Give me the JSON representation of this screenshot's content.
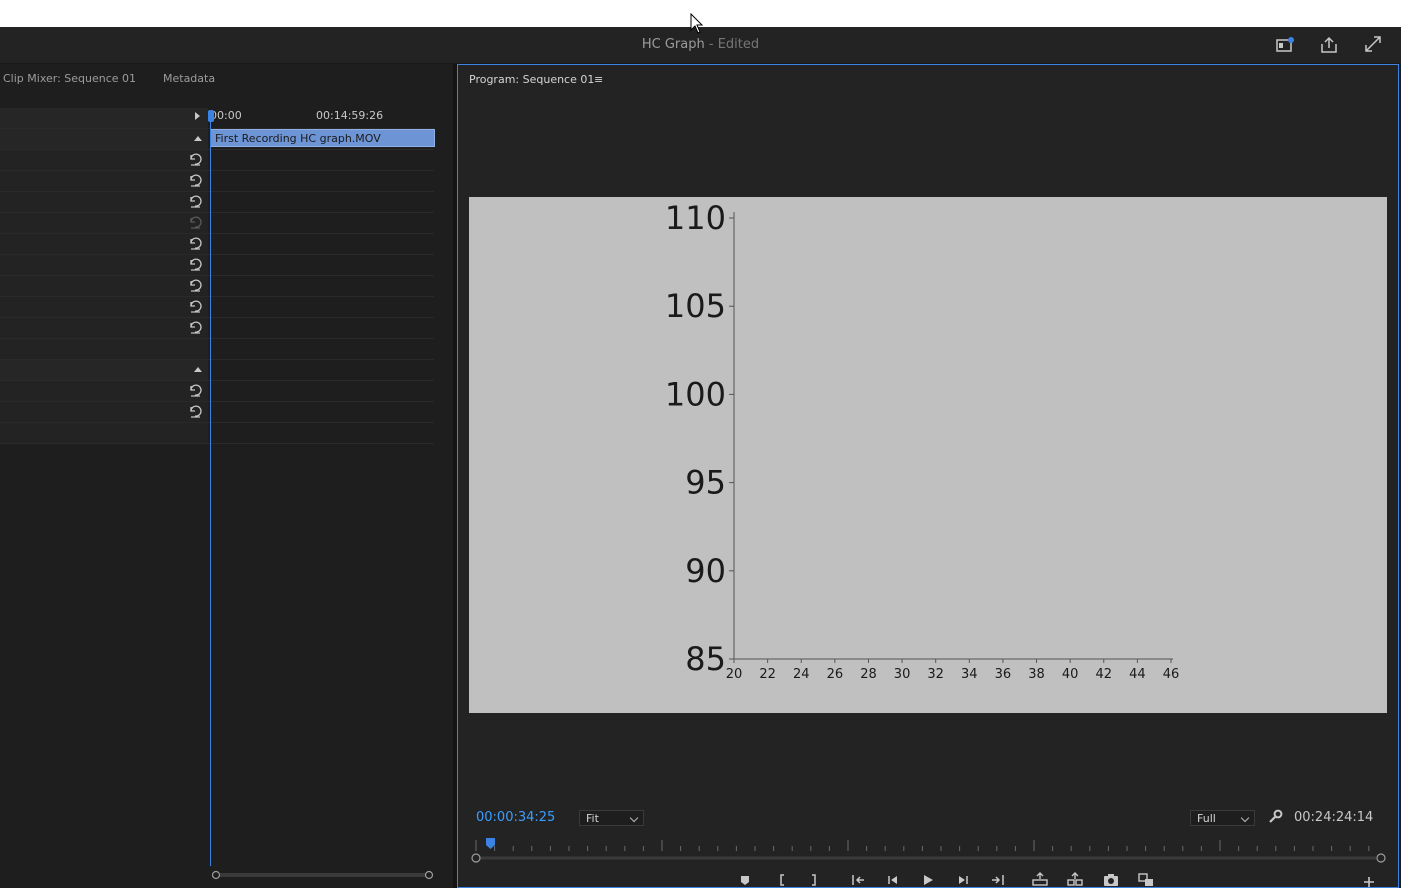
{
  "window": {
    "title": "HC Graph",
    "title_suffix": "- Edited"
  },
  "toolbar_icons": [
    "workspaces-icon",
    "share-icon",
    "fullscreen-icon"
  ],
  "left_panel": {
    "tabs": [
      "Clip Mixer: Sequence 01",
      "Metadata"
    ],
    "ruler": {
      "start": "00:00",
      "mid": "00:14:59:26"
    },
    "clip_name": "First Recording HC graph.MOV"
  },
  "program_monitor": {
    "tab_label": "Program: Sequence 01",
    "menu_glyph": "≡",
    "timecode_current": "00:00:34:25",
    "timecode_total": "00:24:24:14",
    "zoom": "Fit",
    "resolution": "Full"
  },
  "chart_data": {
    "type": "line",
    "x_ticks": [
      20,
      22,
      24,
      26,
      28,
      30,
      32,
      34,
      36,
      38,
      40,
      42,
      44,
      46
    ],
    "y_ticks": [
      85,
      90,
      95,
      100,
      105,
      110
    ],
    "xlim": [
      20,
      46
    ],
    "ylim": [
      85,
      110
    ],
    "series": [],
    "grid": false
  },
  "colors": {
    "accent": "#3b83e2",
    "timecode": "#3b9dff",
    "clip": "#6d95d6"
  }
}
